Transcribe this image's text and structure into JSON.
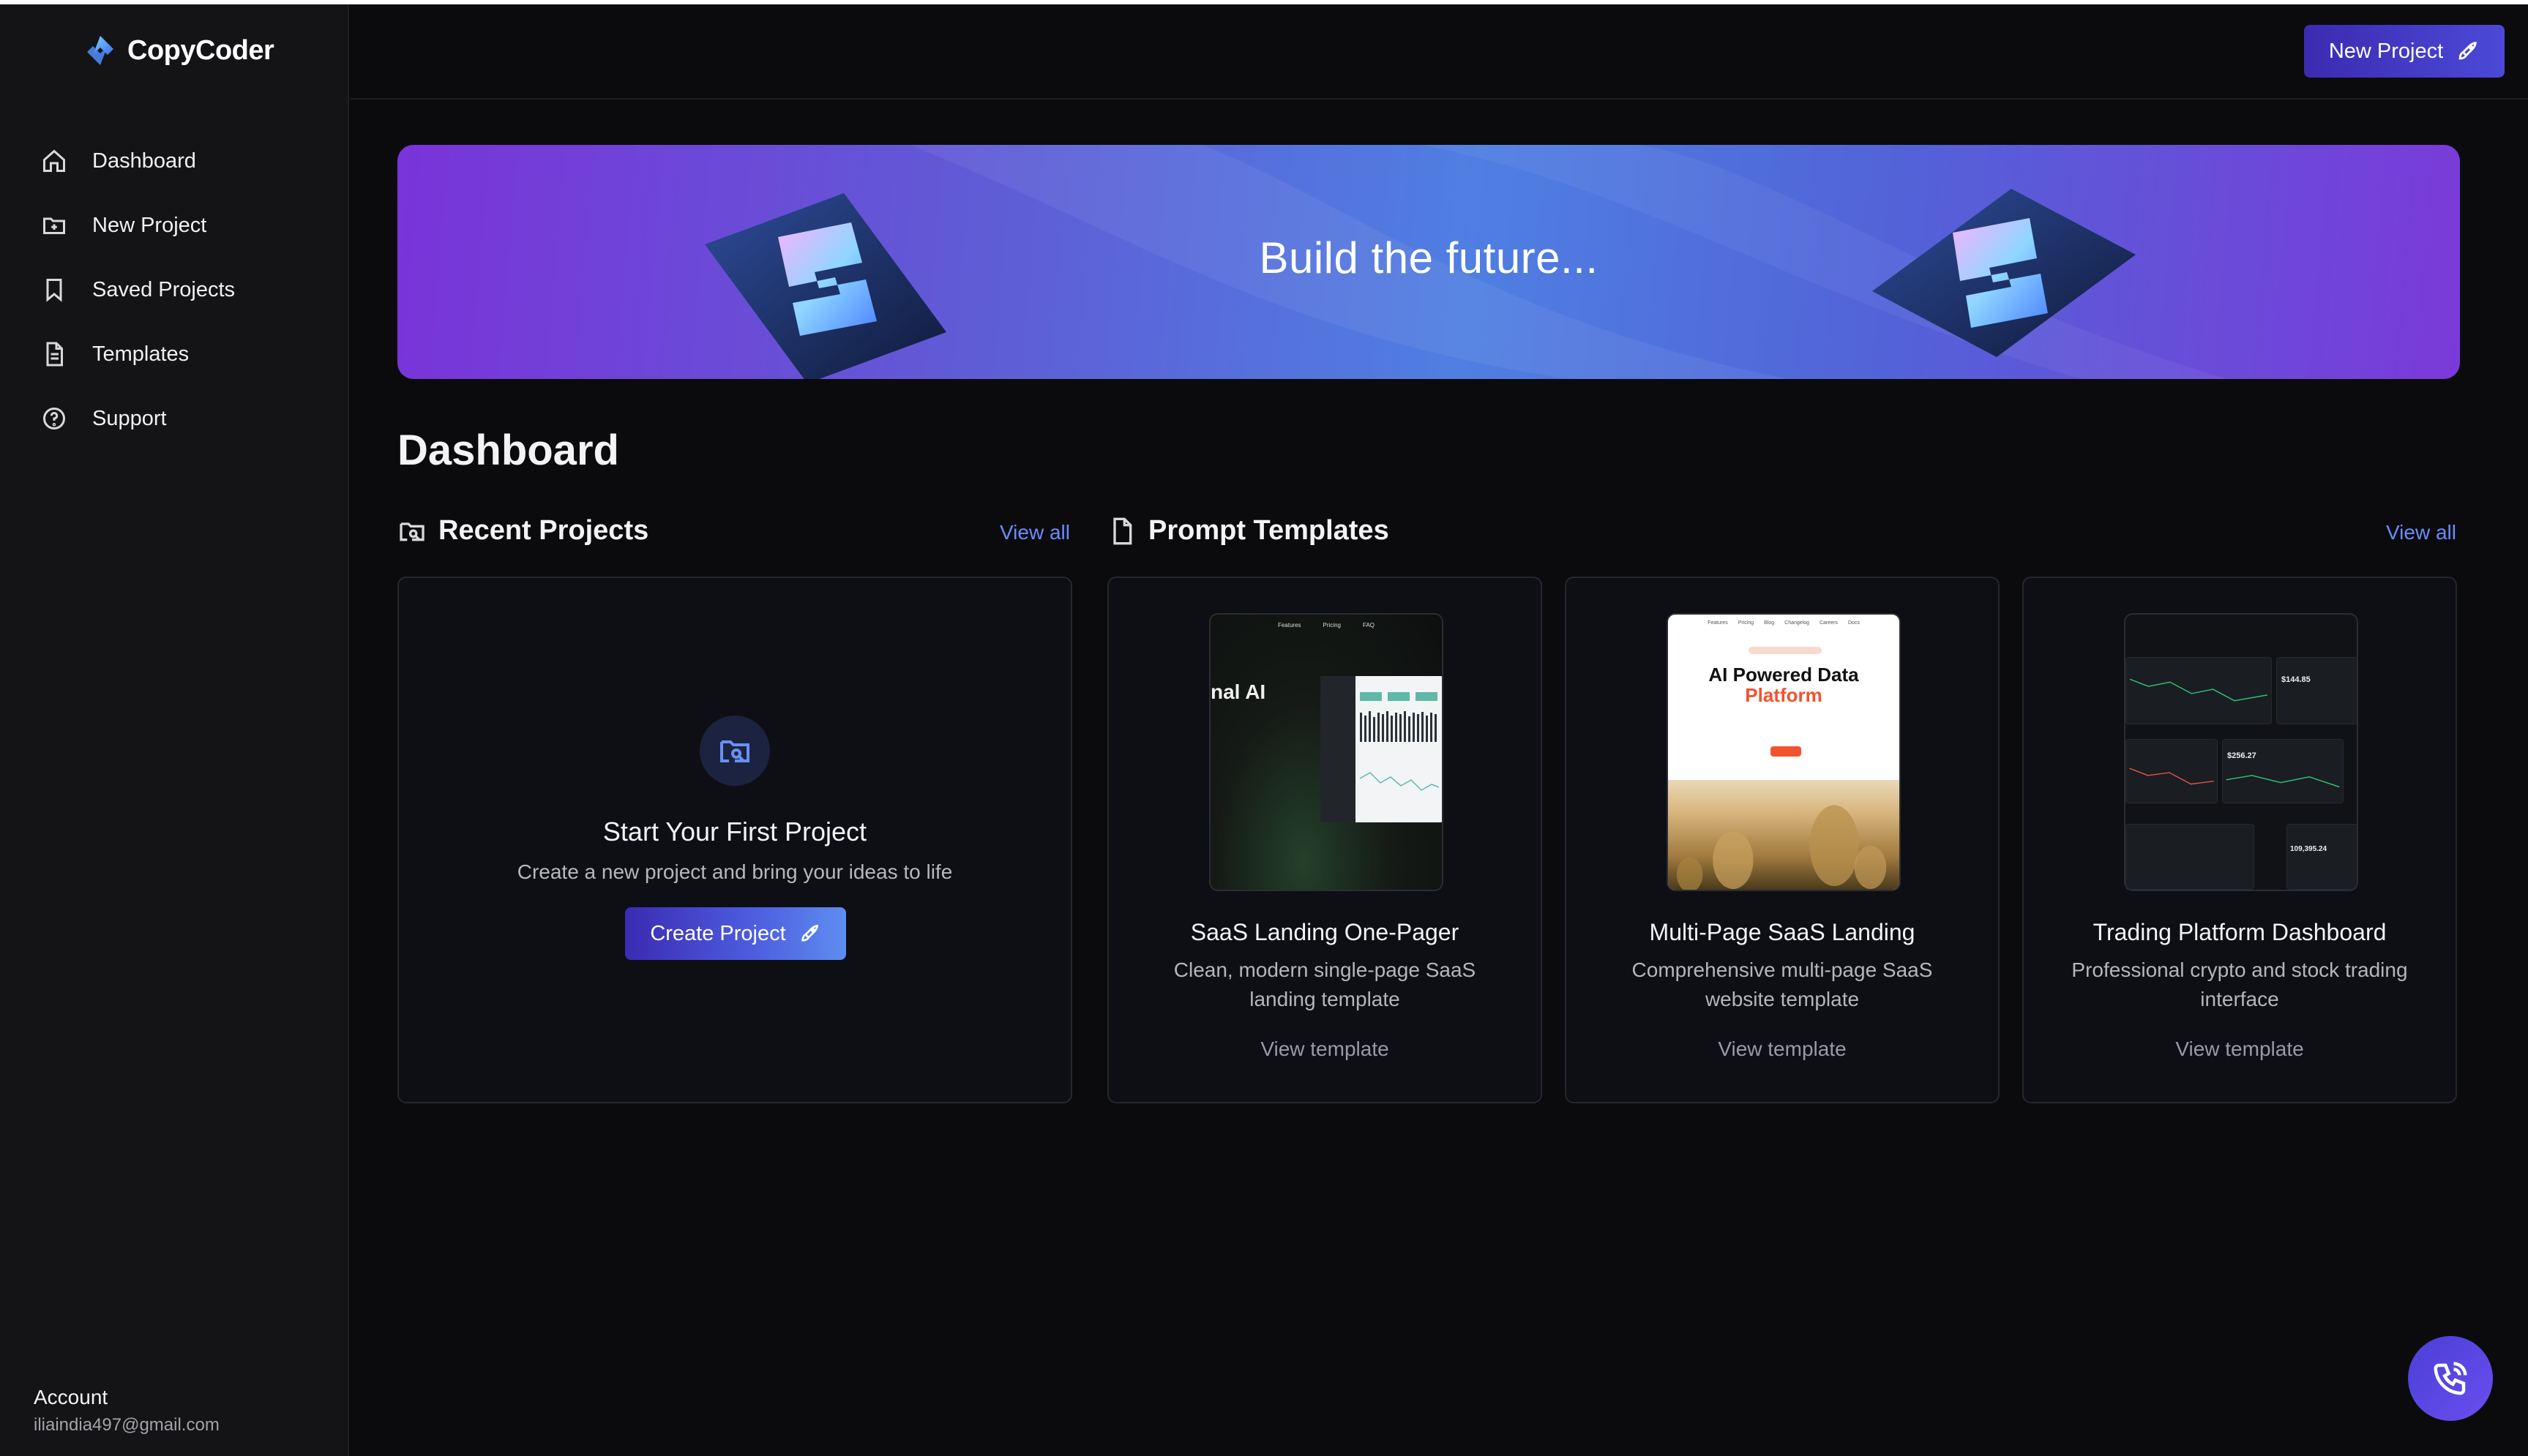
{
  "app": {
    "name": "CopyCoder"
  },
  "sidebar": {
    "items": [
      {
        "label": "Dashboard",
        "icon": "home-icon"
      },
      {
        "label": "New Project",
        "icon": "folder-plus-icon"
      },
      {
        "label": "Saved Projects",
        "icon": "bookmark-icon"
      },
      {
        "label": "Templates",
        "icon": "file-text-icon"
      },
      {
        "label": "Support",
        "icon": "help-circle-icon"
      }
    ],
    "account": {
      "label": "Account",
      "email": "iliaindia497@gmail.com"
    }
  },
  "header": {
    "new_project_label": "New Project"
  },
  "banner": {
    "title": "Build  the future..."
  },
  "main": {
    "title": "Dashboard",
    "recent": {
      "heading": "Recent Projects",
      "view_all": "View all"
    },
    "templates": {
      "heading": "Prompt Templates",
      "view_all": "View all"
    }
  },
  "empty_state": {
    "title": "Start Your First Project",
    "subtitle": "Create a new project and bring your ideas to life",
    "button": "Create Project"
  },
  "templates": [
    {
      "title": "SaaS Landing One-Pager",
      "desc": "Clean, modern single-page SaaS landing template",
      "link": "View template"
    },
    {
      "title": "Multi-Page SaaS Landing",
      "desc": "Comprehensive multi-page SaaS website template",
      "link": "View template"
    },
    {
      "title": "Trading Platform Dashboard",
      "desc": "Professional crypto and stock trading interface",
      "link": "View template"
    }
  ],
  "thumbs": {
    "t1": {
      "nav": [
        "Features",
        "Pricing",
        "FAQ"
      ],
      "hero": "nal AI"
    },
    "t2": {
      "nav": [
        "Features",
        "Pricing",
        "Blog",
        "Changelog",
        "Careers",
        "Docs"
      ],
      "heading_a": "AI Powered Data",
      "heading_b": "Platform"
    },
    "t3": {
      "values": [
        "$144.85",
        "$256.27",
        "109,395.24"
      ]
    }
  },
  "colors": {
    "accent": "#6b8cff",
    "primary_button": "#4c49d8",
    "background": "#0b0b0d",
    "sidebar": "#141416"
  }
}
